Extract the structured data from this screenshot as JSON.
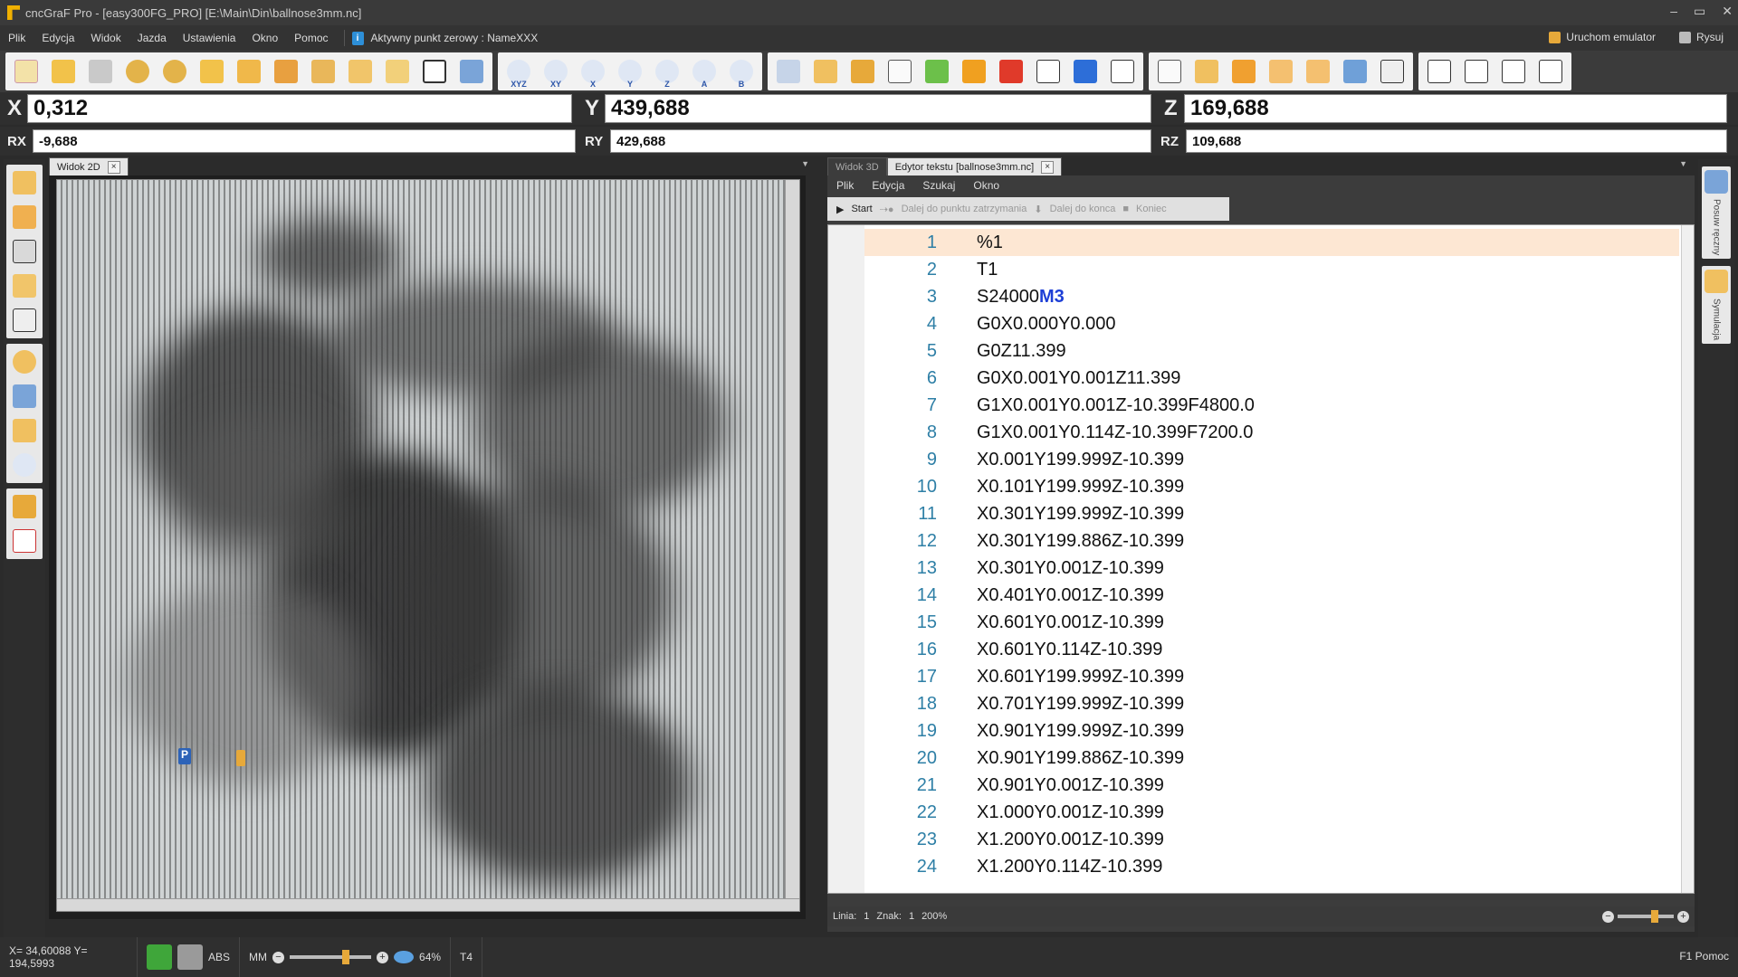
{
  "window": {
    "title": "cncGraF Pro - [easy300FG_PRO] [E:\\Main\\Din\\ballnose3mm.nc]",
    "controls": [
      "–",
      "▭",
      "✕"
    ]
  },
  "menu": {
    "items": [
      "Plik",
      "Edycja",
      "Widok",
      "Jazda",
      "Ustawienia",
      "Okno",
      "Pomoc"
    ],
    "zero_point": "Aktywny punkt zerowy : NameXXX",
    "emulator_label": "Uruchom emulator",
    "draw_label": "Rysuj"
  },
  "toolbar": {
    "axis_labels": [
      "XYZ",
      "XY",
      "X",
      "Y",
      "Z",
      "A",
      "B"
    ]
  },
  "coords": {
    "x_label": "X",
    "x_value": "0,312",
    "y_label": "Y",
    "y_value": "439,688",
    "z_label": "Z",
    "z_value": "169,688",
    "rx_label": "RX",
    "rx_value": "-9,688",
    "ry_label": "RY",
    "ry_value": "429,688",
    "rz_label": "RZ",
    "rz_value": "109,688"
  },
  "tabs": {
    "view2d": "Widok 2D",
    "view3d": "Widok 3D",
    "editor": "Edytor tekstu [ballnose3mm.nc]"
  },
  "editor": {
    "menu": [
      "Plik",
      "Edycja",
      "Szukaj",
      "Okno"
    ],
    "start": "Start",
    "next_breakpoint": "Dalej do punktu zatrzymania",
    "to_end": "Dalej do konca",
    "end": "Koniec",
    "lines": [
      {
        "n": "1",
        "code": "%1"
      },
      {
        "n": "2",
        "code": "T1"
      },
      {
        "n": "3",
        "code": "S24000",
        "kw": "M3"
      },
      {
        "n": "4",
        "code": "G0X0.000Y0.000"
      },
      {
        "n": "5",
        "code": "G0Z11.399"
      },
      {
        "n": "6",
        "code": "G0X0.001Y0.001Z11.399"
      },
      {
        "n": "7",
        "code": "G1X0.001Y0.001Z-10.399F4800.0"
      },
      {
        "n": "8",
        "code": "G1X0.001Y0.114Z-10.399F7200.0"
      },
      {
        "n": "9",
        "code": "X0.001Y199.999Z-10.399"
      },
      {
        "n": "10",
        "code": "X0.101Y199.999Z-10.399"
      },
      {
        "n": "11",
        "code": "X0.301Y199.999Z-10.399"
      },
      {
        "n": "12",
        "code": "X0.301Y199.886Z-10.399"
      },
      {
        "n": "13",
        "code": "X0.301Y0.001Z-10.399"
      },
      {
        "n": "14",
        "code": "X0.401Y0.001Z-10.399"
      },
      {
        "n": "15",
        "code": "X0.601Y0.001Z-10.399"
      },
      {
        "n": "16",
        "code": "X0.601Y0.114Z-10.399"
      },
      {
        "n": "17",
        "code": "X0.601Y199.999Z-10.399"
      },
      {
        "n": "18",
        "code": "X0.701Y199.999Z-10.399"
      },
      {
        "n": "19",
        "code": "X0.901Y199.999Z-10.399"
      },
      {
        "n": "20",
        "code": "X0.901Y199.886Z-10.399"
      },
      {
        "n": "21",
        "code": "X0.901Y0.001Z-10.399"
      },
      {
        "n": "22",
        "code": "X1.000Y0.001Z-10.399"
      },
      {
        "n": "23",
        "code": "X1.200Y0.001Z-10.399"
      },
      {
        "n": "24",
        "code": "X1.200Y0.114Z-10.399"
      }
    ],
    "status_line_label": "Linia:",
    "status_line": "1",
    "status_char_label": "Znak:",
    "status_char": "1",
    "status_zoom": "200%"
  },
  "rightdock": {
    "manual": "Posuw ręczny",
    "simulation": "Symulacja"
  },
  "status": {
    "position": "X= 34,60088 Y= 194,5993",
    "abs": "ABS",
    "unit": "MM",
    "percent": "64%",
    "tool": "T4",
    "help": "F1 Pomoc"
  },
  "colors": {
    "accent": "#e7a93a",
    "keyword": "#1d3fd6",
    "line_number": "#2e7fa6",
    "current_line": "#fde7d3"
  }
}
